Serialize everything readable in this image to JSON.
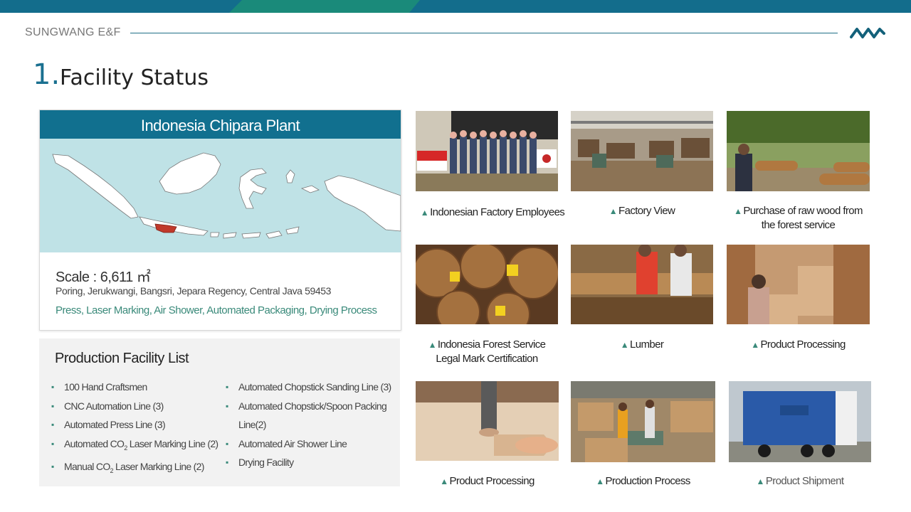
{
  "header": {
    "brand": "SUNGWANG E&F"
  },
  "title": {
    "number": "1.",
    "text": "Facility Status"
  },
  "plant": {
    "name": "Indonesia Chipara Plant",
    "scale": "Scale : 6,611 ㎡",
    "address": "Poring, Jerukwangi, Bangsri, Jepara Regency, Central Java 59453",
    "features": "Press, Laser Marking, Air Shower, Automated Packaging, Drying Process"
  },
  "facility": {
    "title": "Production Facility List",
    "left": [
      {
        "text": "100 Hand Craftsmen"
      },
      {
        "text": "CNC Automation Line (3)"
      },
      {
        "text": "Automated Press Line (3)"
      },
      {
        "pre": "Automated CO",
        "sub": "2",
        "post": " Laser Marking Line (2)"
      },
      {
        "pre": "Manual CO",
        "sub": "2",
        "post": " Laser Marking Line (2)"
      }
    ],
    "right": [
      {
        "text": "Automated Chopstick Sanding Line (3)"
      },
      {
        "text": "Automated Chopstick/Spoon Packing Line(2)"
      },
      {
        "text": "Automated Air Shower Line"
      },
      {
        "text": "Drying Facility"
      }
    ]
  },
  "photos": {
    "captions": [
      "Indonesian Factory Employees",
      "Factory View",
      "Purchase of raw wood from the forest service",
      "Indonesia Forest Service Legal Mark Certification",
      "Lumber",
      "Product Processing",
      "Product Processing",
      "Production Process",
      "Product Shipment"
    ],
    "triangle": "▲"
  },
  "colors": {
    "accent": "#11708f",
    "green": "#3a8a7a",
    "map_bg": "#bfe2e6",
    "highlight": "#c0392b"
  }
}
